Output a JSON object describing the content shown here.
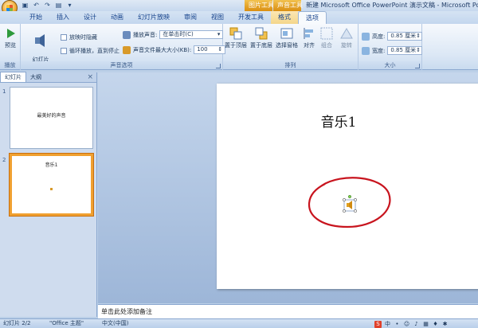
{
  "title_bar": {
    "context_picture_tools": "图片工具",
    "context_sound_tools": "声音工具",
    "window_title": "新建 Microsoft Office PowerPoint 演示文稿 - Microsoft PowerPoint"
  },
  "tabs": [
    "开始",
    "插入",
    "设计",
    "动画",
    "幻灯片放映",
    "审阅",
    "视图",
    "开发工具",
    "格式",
    "选项"
  ],
  "ribbon": {
    "preview": {
      "label": "预览",
      "group": "播放"
    },
    "sound_options": {
      "slide_volume": "幻灯片\n放映音量",
      "hide_during_show": "放映时隐藏",
      "loop_until_stopped": "循环播放，直到停止",
      "play_sound_label": "播放声音:",
      "play_sound_value": "在单击时(C)",
      "max_file_size_label": "声音文件最大大小(KB):",
      "max_file_size_value": "100",
      "group": "声音选项"
    },
    "arrange": {
      "bring_to_front": "置于顶层",
      "send_to_back": "置于底层",
      "selection_pane": "选择窗格",
      "align": "对齐",
      "group_btn": "组合",
      "rotate": "旋转",
      "group": "排列"
    },
    "size": {
      "height_label": "高度:",
      "height_value": "0.85 厘米",
      "width_label": "宽度:",
      "width_value": "0.85 厘米",
      "group": "大小"
    }
  },
  "left_pane": {
    "tab_slides": "幻灯片",
    "tab_outline": "大纲",
    "close": "×",
    "slides": [
      {
        "num": "1",
        "title": "最美好的声音"
      },
      {
        "num": "2",
        "title": "音乐1"
      }
    ]
  },
  "slide": {
    "title": "音乐1"
  },
  "notes_placeholder": "单击此处添加备注",
  "status_bar": {
    "slide_info": "幻灯片 2/2",
    "theme": "\"Office 主题\"",
    "language": "中文(中国)"
  },
  "colors": {
    "accent_orange": "#f0a030",
    "ribbon_blue": "#dbe7f5",
    "circle_red": "#c8141e"
  }
}
